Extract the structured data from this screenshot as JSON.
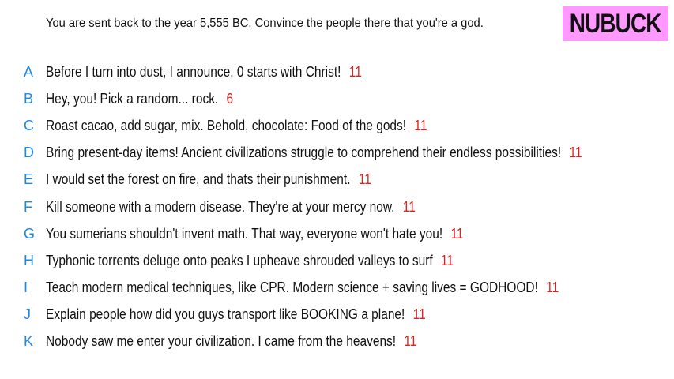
{
  "prompt": "You are sent back to the year 5,555 BC. Convince the people there that you're a god.",
  "badge": {
    "label": "NUBUCK",
    "color": "#ff99ff"
  },
  "colors": {
    "letter": "#1e88e5",
    "score": "#e02020",
    "text": "#111111"
  },
  "answers": [
    {
      "letter": "A",
      "text": "Before I turn into dust, I announce, 0 starts with Christ!",
      "score": "11"
    },
    {
      "letter": "B",
      "text": "Hey, you! Pick a random... rock.",
      "score": "6"
    },
    {
      "letter": "C",
      "text": "Roast cacao, add sugar, mix. Behold, chocolate: Food of the gods!",
      "score": "11"
    },
    {
      "letter": "D",
      "text": "Bring present-day items! Ancient civilizations struggle to comprehend their endless possibilities!",
      "score": "11"
    },
    {
      "letter": "E",
      "text": "I would set the forest on fire, and thats their punishment.",
      "score": "11"
    },
    {
      "letter": "F",
      "text": "Kill someone with a modern disease. They're at your mercy now.",
      "score": "11"
    },
    {
      "letter": "G",
      "text": "You sumerians shouldn't invent math. That way, everyone won't hate you!",
      "score": "11"
    },
    {
      "letter": "H",
      "text": "Typhonic torrents deluge onto peaks I upheave shrouded valleys to surf",
      "score": "11"
    },
    {
      "letter": "I",
      "text": "Teach modern medical techniques, like CPR. Modern science + saving lives = GODHOOD!",
      "score": "11"
    },
    {
      "letter": "J",
      "text": "Explain people how did you guys transport like BOOKING a plane!",
      "score": "11"
    },
    {
      "letter": "K",
      "text": "Nobody saw me enter your civilization. I came from the heavens!",
      "score": "11"
    }
  ]
}
